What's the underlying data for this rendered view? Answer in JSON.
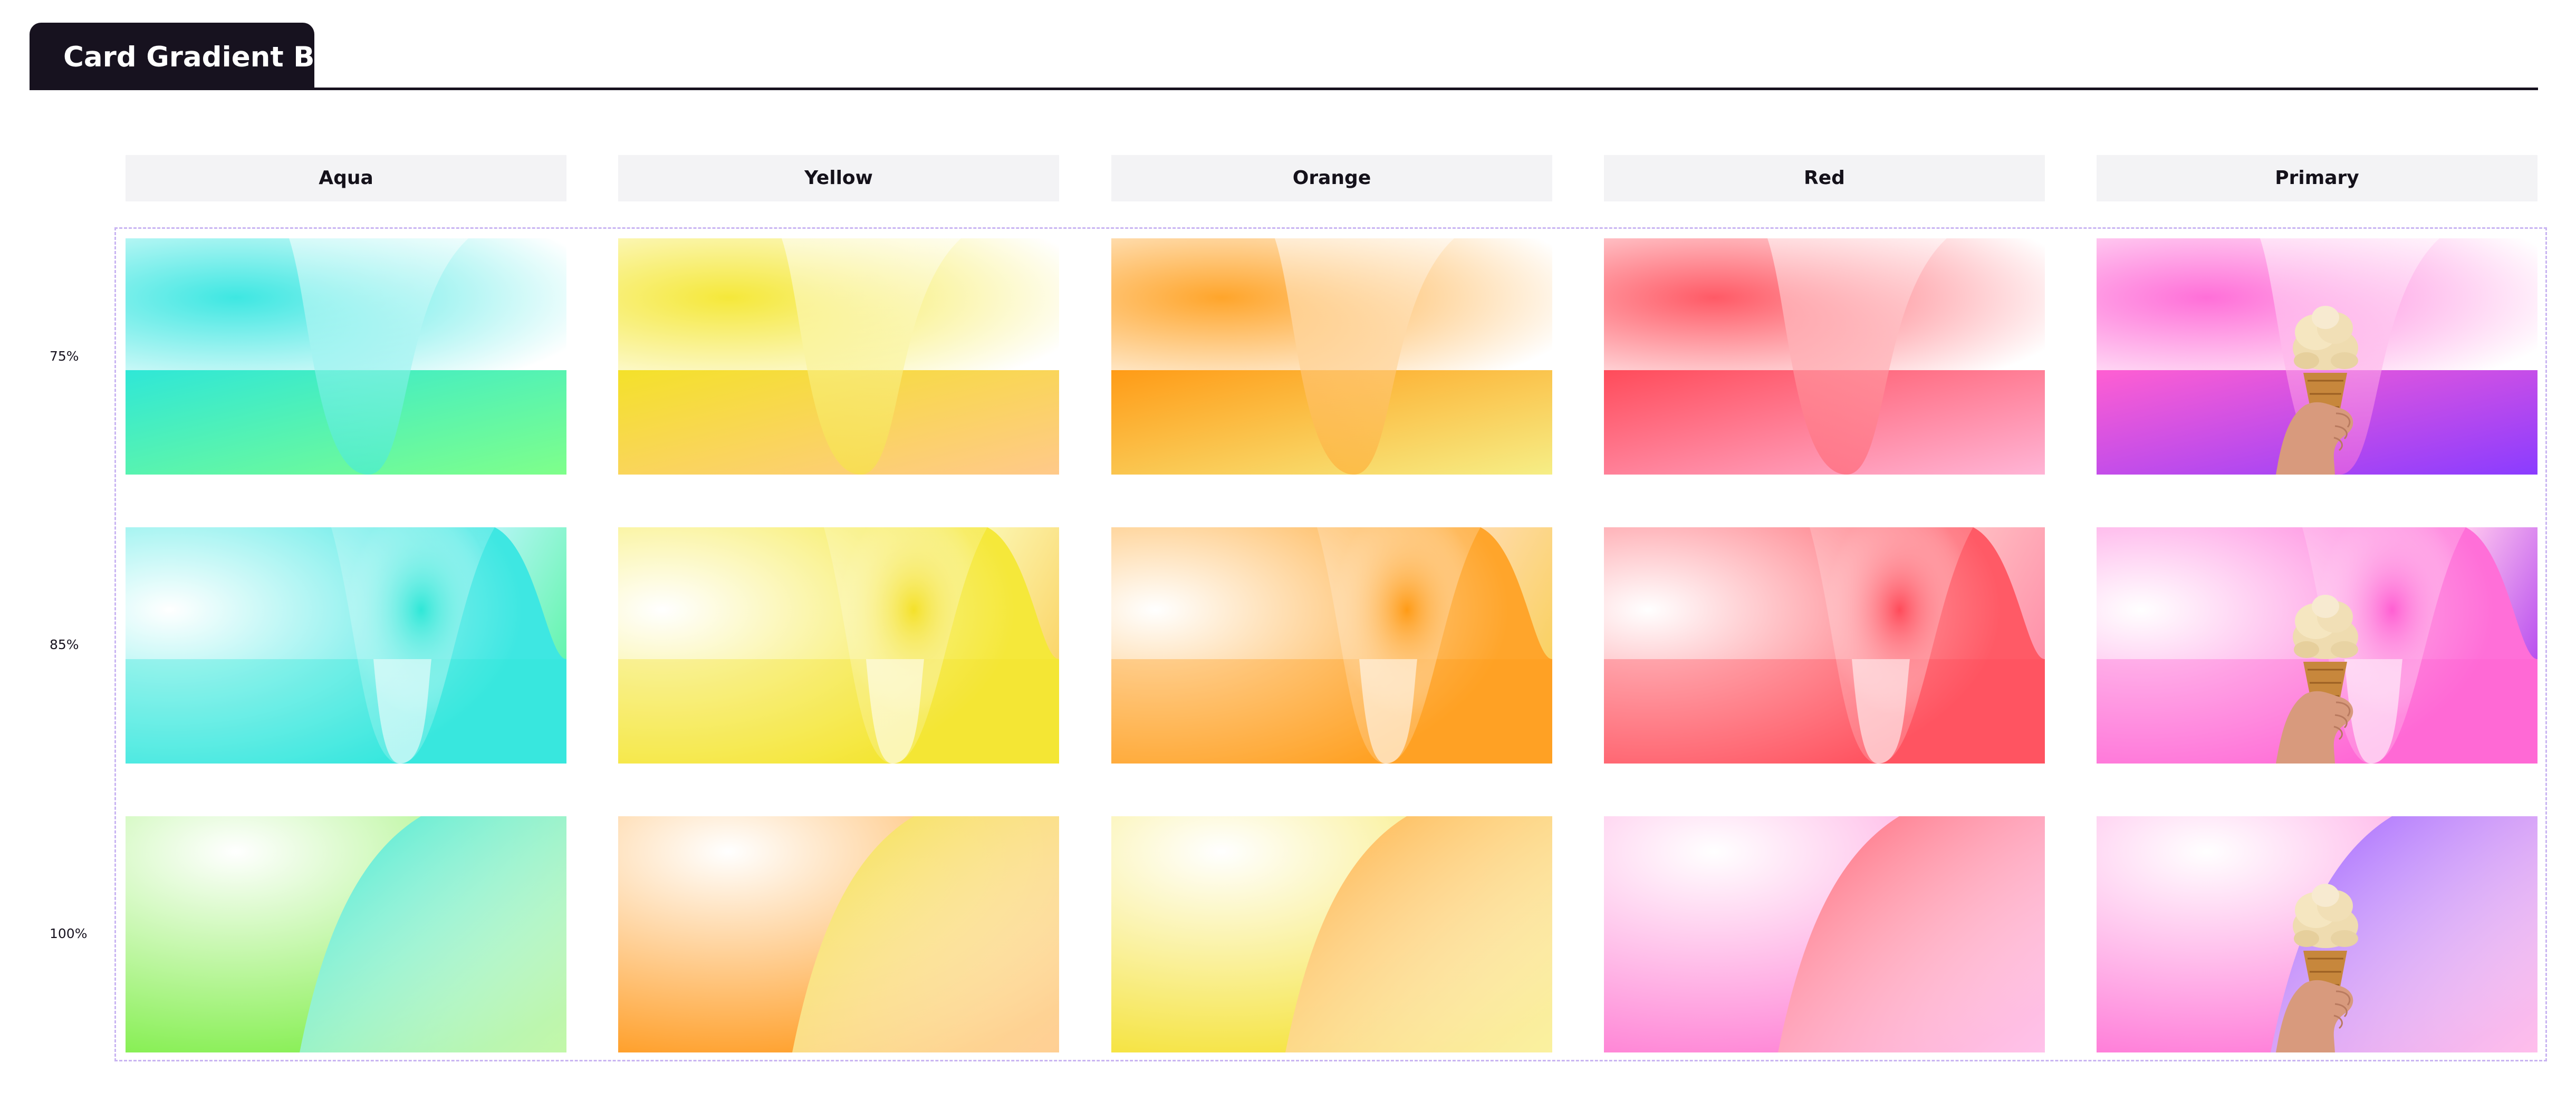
{
  "header": {
    "title": "Card Gradient Bg"
  },
  "columns": [
    {
      "label": "Aqua",
      "light": "#ffffff",
      "accent": "#3ee7e2",
      "deep": "#2fe7d7",
      "alt": "#7fff8a",
      "variant100": "#78ed3e",
      "tint100": "#3ee8cf"
    },
    {
      "label": "Yellow",
      "light": "#ffffff",
      "accent": "#f5e83a",
      "deep": "#f4e12a",
      "alt": "#ffc98a",
      "variant100": "#ff9411",
      "tint100": "#f5dd40"
    },
    {
      "label": "Orange",
      "light": "#ffffff",
      "accent": "#ffa52b",
      "deep": "#ff9b16",
      "alt": "#f6ee86",
      "variant100": "#f4e02a",
      "tint100": "#ffad38"
    },
    {
      "label": "Red",
      "light": "#ffffff",
      "accent": "#ff5a66",
      "deep": "#ff4b5a",
      "alt": "#ffb5d6",
      "variant100": "#ff77d1",
      "tint100": "#ff5d6f"
    },
    {
      "label": "Primary",
      "light": "#ffffff",
      "accent": "#ff6fd8",
      "deep": "#ff5fd2",
      "alt": "#8a3cff",
      "variant100": "#ff6ed4",
      "tint100": "#9a58ff"
    }
  ],
  "rows": [
    {
      "label": "75%"
    },
    {
      "label": "85%"
    },
    {
      "label": "100%"
    }
  ],
  "frame_color": "#c9b5f2"
}
